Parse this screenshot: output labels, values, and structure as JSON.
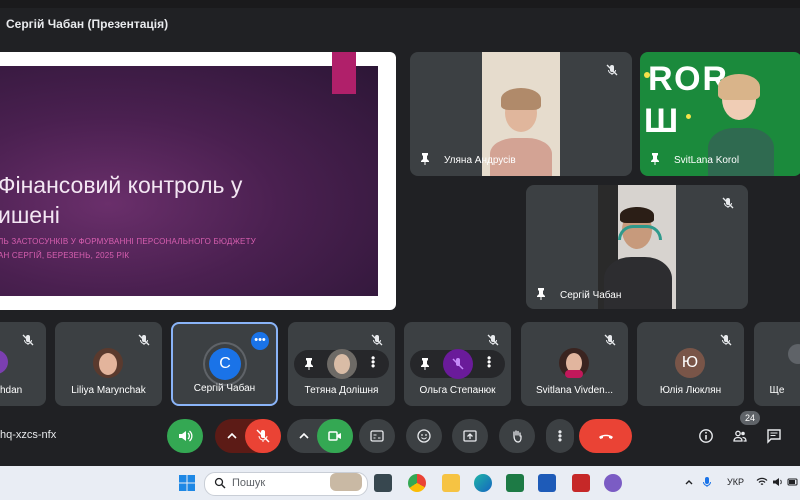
{
  "window": {
    "title": "Сергій Чабан (Презентація)"
  },
  "slide": {
    "title": "Фінансовий контроль у\nишені",
    "subtitle": "ЛЬ ЗАСТОСУНКІВ У ФОРМУВАННІ ПЕРСОНАЛЬНОГО БЮДЖЕТУ\nАН СЕРГІЙ, БЕРЕЗЕНЬ, 2025 РІК"
  },
  "video_tiles": [
    {
      "name": "Уляна Андрусів"
    },
    {
      "name": "SvitLana Korol"
    },
    {
      "name": "Сергій Чабан"
    }
  ],
  "participants": [
    {
      "name": "hdan"
    },
    {
      "name": "Liliya Marynchak"
    },
    {
      "name": "Сергій Чабан",
      "initial": "С"
    },
    {
      "name": "Тетяна Долішня"
    },
    {
      "name": "Ольга Степанюк"
    },
    {
      "name": "Svitlana Vivden..."
    },
    {
      "name": "Юлія Люклян",
      "initial": "Ю"
    },
    {
      "name": "Ще"
    }
  ],
  "meeting": {
    "code": "hq-xzcs-nfx",
    "participant_count": "24"
  },
  "taskbar": {
    "search_placeholder": "Пошук",
    "language": "УКР"
  },
  "colors": {
    "accent_blue": "#8ab4f8",
    "end_call_red": "#ea4335",
    "mic_off_red": "#ea4335",
    "camera_green": "#34a853"
  }
}
